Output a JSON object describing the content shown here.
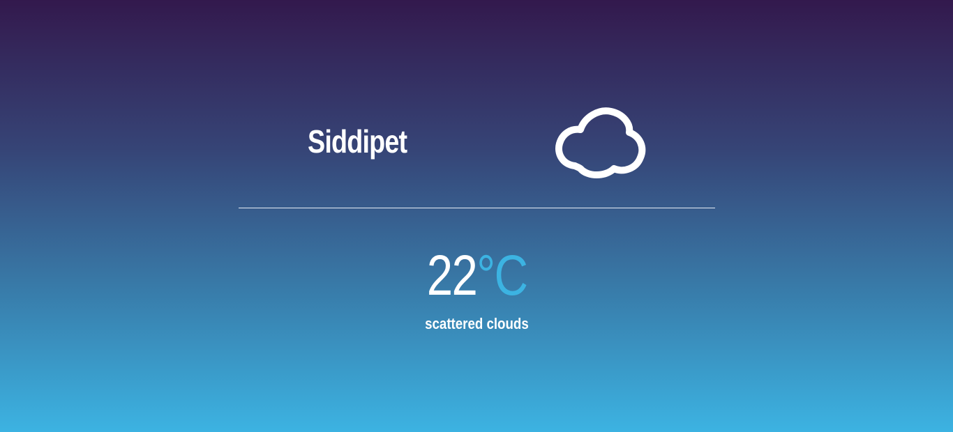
{
  "location": {
    "city": "Siddipet"
  },
  "current": {
    "temperature": "22",
    "unit": "°C",
    "description": "scattered clouds",
    "icon": "cloud-icon"
  },
  "colors": {
    "accent": "#3cb3e2",
    "text": "#ffffff",
    "gradient_top": "#33194d",
    "gradient_bottom": "#3cb3e2"
  }
}
